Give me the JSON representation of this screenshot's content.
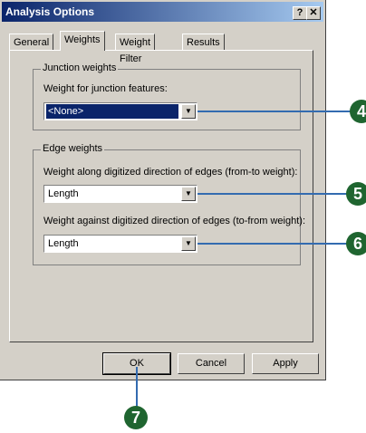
{
  "window": {
    "title": "Analysis Options",
    "help_label": "?",
    "close_label": "✕"
  },
  "tabs": [
    {
      "label": "General"
    },
    {
      "label": "Weights"
    },
    {
      "label": "Weight Filter"
    },
    {
      "label": "Results"
    }
  ],
  "junction_group": {
    "title": "Junction weights",
    "field_label": "Weight for junction features:",
    "value": "<None>"
  },
  "edge_group": {
    "title": "Edge weights",
    "from_to_label": "Weight along digitized direction of edges (from-to weight):",
    "from_to_value": "Length",
    "to_from_label": "Weight against digitized direction of edges (to-from weight):",
    "to_from_value": "Length"
  },
  "buttons": {
    "ok": "OK",
    "cancel": "Cancel",
    "apply": "Apply"
  },
  "callouts": [
    "4",
    "5",
    "6",
    "7"
  ],
  "colors": {
    "title_bar": "#0a246a",
    "dialog_face": "#d4d0c8",
    "callout_line": "#336bb0",
    "marker": "#1f6530"
  }
}
